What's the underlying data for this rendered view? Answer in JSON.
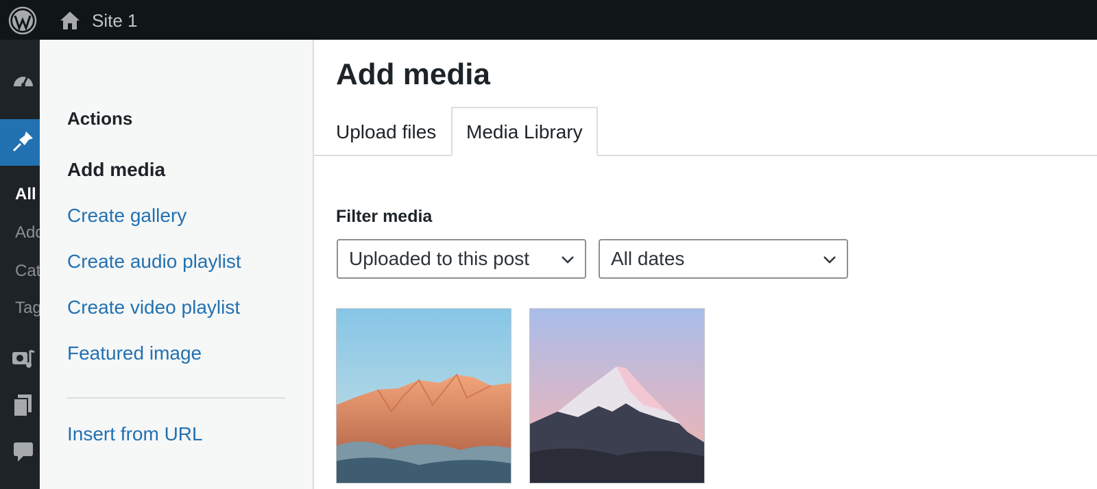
{
  "adminbar": {
    "site_title": "Site 1"
  },
  "admin_submenu": [
    "All",
    "Add",
    "Cat",
    "Tag"
  ],
  "modal": {
    "actions_title": "Actions",
    "menu": [
      {
        "label": "Add media",
        "active": true
      },
      {
        "label": "Create gallery"
      },
      {
        "label": "Create audio playlist"
      },
      {
        "label": "Create video playlist"
      },
      {
        "label": "Featured image"
      }
    ],
    "insert_from_url": "Insert from URL",
    "title": "Add media",
    "tabs": [
      {
        "label": "Upload files"
      },
      {
        "label": "Media Library",
        "active": true
      }
    ],
    "filter_label": "Filter media",
    "filters": {
      "type_selected": "Uploaded to this post",
      "date_selected": "All dates"
    }
  },
  "colors": {
    "link": "#2271b1",
    "admin_bar": "#101517",
    "admin_menu": "#1d2327"
  }
}
